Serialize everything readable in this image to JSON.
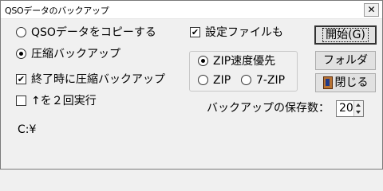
{
  "window": {
    "title": "QSOデータのバックアップ",
    "close_glyph": "✕"
  },
  "options": {
    "copy_radio": {
      "label": "QSOデータをコピーする",
      "selected": false
    },
    "compress_radio": {
      "label": "圧縮バックアップ",
      "selected": true
    },
    "compress_on_exit": {
      "label": "終了時に圧縮バックアップ",
      "checked": true
    },
    "repeat_twice": {
      "label": "↑を２回実行",
      "checked": false
    },
    "settings_file": {
      "label": "設定ファイルも",
      "checked": true
    }
  },
  "zip_group": {
    "zip_speed": {
      "label": "ZIP速度優先",
      "selected": true
    },
    "zip": {
      "label": "ZIP",
      "selected": false
    },
    "seven_zip": {
      "label": "7-ZIP",
      "selected": false
    }
  },
  "buttons": {
    "start": "開始(G)",
    "folder": "フォルダ",
    "close": "閉じる"
  },
  "backup_count": {
    "label": "バックアップの保存数：",
    "value": "20"
  },
  "path": "C:¥",
  "icons": {
    "close_window": "close-icon",
    "close_button": "door-exit-icon",
    "check_mark": "✔"
  }
}
